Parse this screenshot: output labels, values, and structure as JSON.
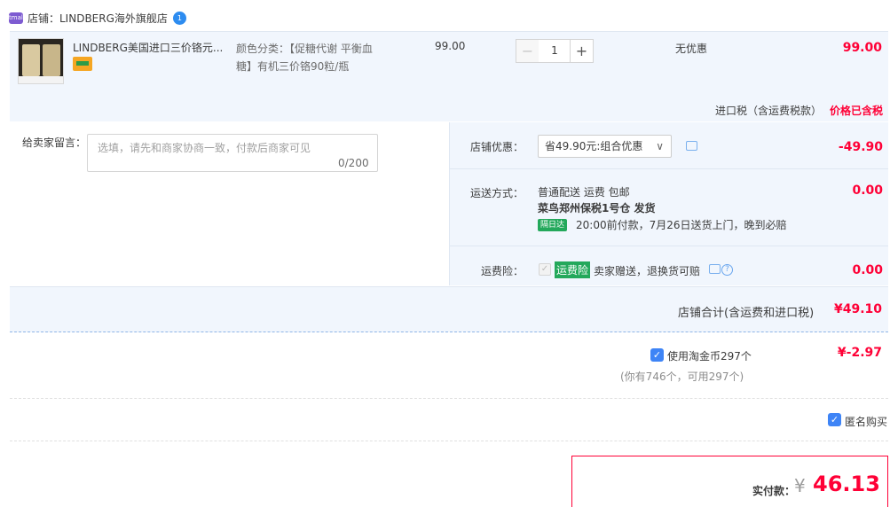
{
  "shop": {
    "logo_text": "tmall",
    "name": "店铺：LINDBERG海外旗舰店",
    "chat_badge": "1"
  },
  "item": {
    "title": "LINDBERG美国进口三价铬元...",
    "sku": "颜色分类：【促糖代谢 平衡血糖】有机三价铬90粒/瓶",
    "unit_price": "99.00",
    "quantity": "1",
    "minus_label": "−",
    "plus_label": "+",
    "discount": "无优惠",
    "subtotal": "99.00"
  },
  "tax": {
    "label": "进口税（含运费税款）",
    "value": "价格已含税"
  },
  "message": {
    "label": "给卖家留言：",
    "placeholder": "选填，请先和商家协商一致，付款后商家可见",
    "count": "0/200"
  },
  "shop_discount": {
    "label": "店铺优惠：",
    "selected": "省49.90元:组合优惠",
    "value": "-49.90"
  },
  "shipping": {
    "label": "运送方式：",
    "line1": "普通配送 运费 包邮",
    "line2": "菜鸟郑州保税1号仓  发货",
    "badge": "隔日达",
    "line3": "20:00前付款，7月26日送货上门，晚到必赔",
    "value": "0.00"
  },
  "insurance": {
    "label": "运费险：",
    "tag": "运费险",
    "text": "卖家赠送，退换货可赔",
    "value": "0.00"
  },
  "shop_total": {
    "label": "店铺合计(含运费和进口税)",
    "value": "¥49.10"
  },
  "coins": {
    "label": "使用淘金币297个",
    "value": "¥-2.97",
    "note": "(你有746个，可用297个)"
  },
  "anonymous": {
    "label": "匿名购买"
  },
  "payment": {
    "label": "实付款：",
    "currency": "¥",
    "value": "46.13"
  },
  "colors": {
    "accent_red": "#ff0036",
    "panel_blue": "#f1f6fd",
    "check_blue": "#3e84f6",
    "badge_green": "#23a85b"
  }
}
